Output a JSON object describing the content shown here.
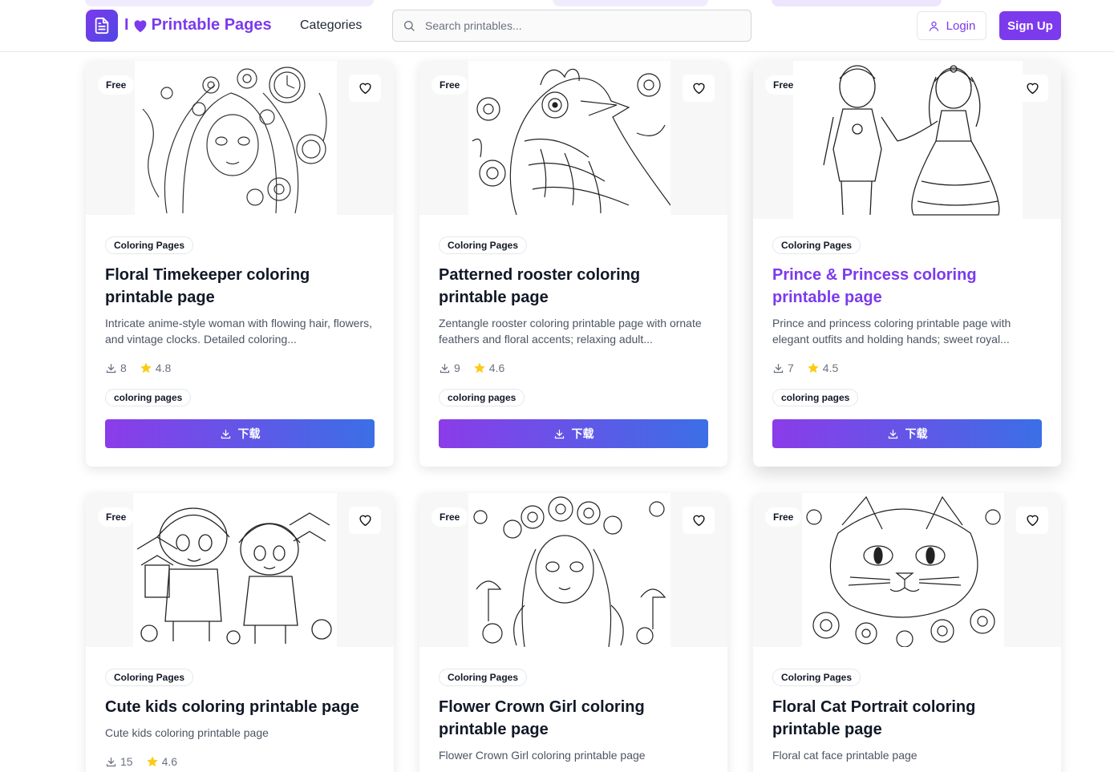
{
  "header": {
    "logo_prefix": "I",
    "logo_name": "Printable Pages",
    "nav_categories": "Categories",
    "search_placeholder": "Search printables...",
    "login_label": "Login",
    "signup_label": "Sign Up"
  },
  "colors": {
    "brand": "#7c3aed",
    "button_gradient_start": "#8b3ce8",
    "button_gradient_end": "#3b6fe6",
    "star": "#facc15"
  },
  "cards": [
    {
      "badge": "Free",
      "category": "Coloring Pages",
      "title": "Floral Timekeeper coloring printable page",
      "description": "Intricate anime-style woman with flowing hair, flowers, and vintage clocks. Detailed coloring...",
      "downloads": "8",
      "rating": "4.8",
      "tag": "coloring pages",
      "button_label": "下载",
      "image_icon": "girl-flowers-illustration"
    },
    {
      "badge": "Free",
      "category": "Coloring Pages",
      "title": "Patterned rooster coloring printable page",
      "description": "Zentangle rooster coloring printable page with ornate feathers and floral accents; relaxing adult...",
      "downloads": "9",
      "rating": "4.6",
      "tag": "coloring pages",
      "button_label": "下载",
      "image_icon": "rooster-illustration"
    },
    {
      "badge": "Free",
      "category": "Coloring Pages",
      "title": "Prince & Princess coloring printable page",
      "description": "Prince and princess coloring printable page with elegant outfits and holding hands; sweet royal...",
      "downloads": "7",
      "rating": "4.5",
      "tag": "coloring pages",
      "button_label": "下载",
      "image_icon": "prince-princess-illustration"
    },
    {
      "badge": "Free",
      "category": "Coloring Pages",
      "title": "Cute kids coloring printable page",
      "description": "Cute kids coloring printable page",
      "downloads": "15",
      "rating": "4.6",
      "image_icon": "kids-illustration"
    },
    {
      "badge": "Free",
      "category": "Coloring Pages",
      "title": "Flower Crown Girl coloring printable page",
      "description": "Flower Crown Girl coloring printable page",
      "image_icon": "flower-crown-girl-illustration"
    },
    {
      "badge": "Free",
      "category": "Coloring Pages",
      "title": "Floral Cat Portrait coloring printable page",
      "description": "Floral cat face printable page",
      "image_icon": "cat-illustration"
    }
  ]
}
